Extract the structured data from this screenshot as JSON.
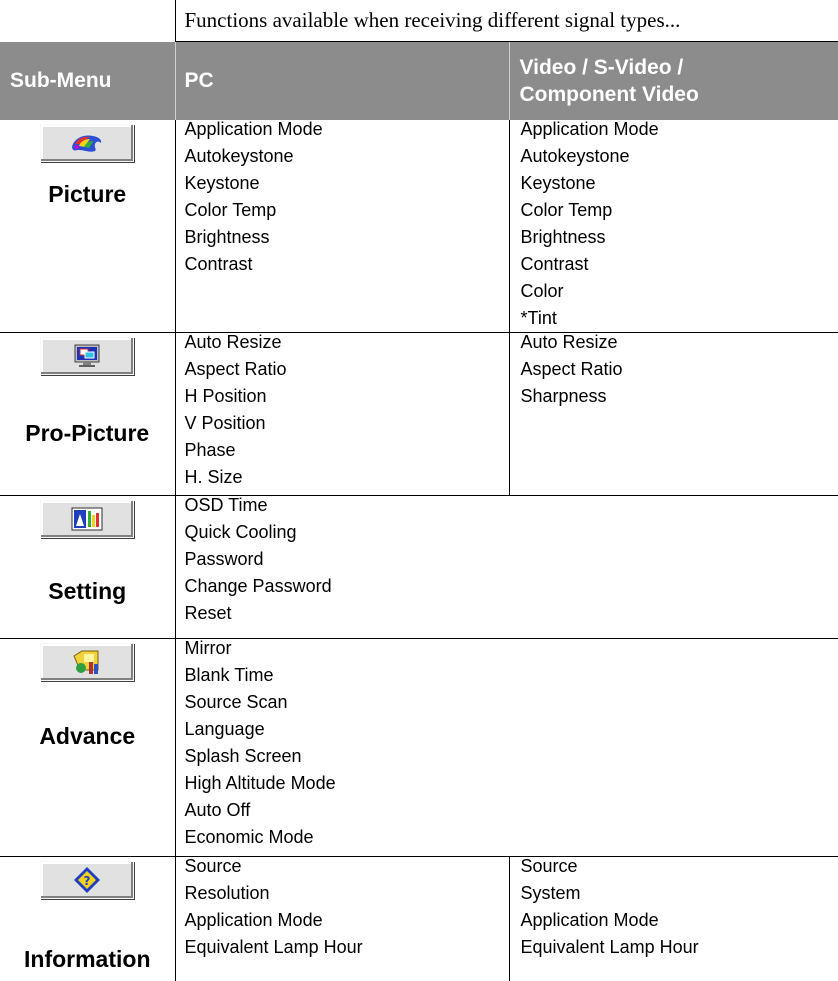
{
  "caption": "Functions available when receiving different signal types...",
  "headers": {
    "submenu": "Sub-Menu",
    "pc": "PC",
    "video_line1": "Video / S-Video /",
    "video_line2": "Component Video"
  },
  "rows": [
    {
      "name": "Picture",
      "icon": "color-palette-icon",
      "pc": [
        "Application Mode",
        "Autokeystone",
        "Keystone",
        "Color Temp",
        "Brightness",
        "Contrast"
      ],
      "video": [
        "Application Mode",
        "Autokeystone",
        "Keystone",
        "Color Temp",
        "Brightness",
        "Contrast",
        "Color",
        "*Tint"
      ]
    },
    {
      "name": "Pro-Picture",
      "icon": "monitor-window-icon",
      "pc": [
        "Auto Resize",
        "Aspect Ratio",
        "H Position",
        "V Position",
        "Phase",
        "H. Size"
      ],
      "video": [
        "Auto Resize",
        "Aspect Ratio",
        "Sharpness"
      ]
    },
    {
      "name": "Setting",
      "icon": "settings-panel-icon",
      "pc": [
        "OSD Time",
        "Quick Cooling",
        "Password",
        "Change Password",
        "Reset"
      ],
      "video": []
    },
    {
      "name": "Advance",
      "icon": "advanced-tools-icon",
      "pc": [
        "Mirror",
        "Blank Time",
        "Source Scan",
        "Language",
        "Splash Screen",
        "High Altitude Mode",
        "Auto Off",
        "Economic Mode"
      ],
      "video": []
    },
    {
      "name": "Information",
      "icon": "question-diamond-icon",
      "pc": [
        "Source",
        "Resolution",
        "Application Mode",
        "Equivalent Lamp Hour"
      ],
      "video": [
        "Source",
        "System",
        "Application Mode",
        "Equivalent Lamp Hour"
      ]
    }
  ],
  "colors": {
    "header_bg": "#8c8c8c",
    "header_text": "#ffffff",
    "border": "#000000",
    "button_face": "#e1e1e1"
  }
}
